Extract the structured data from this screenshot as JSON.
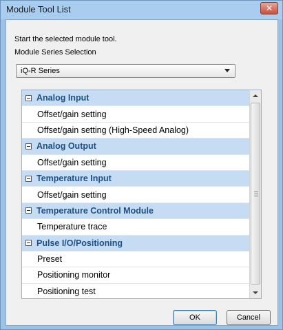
{
  "window": {
    "title": "Module Tool List",
    "close_glyph": "✕"
  },
  "dialog": {
    "instruction": "Start the selected module tool.",
    "series_label": "Module Series Selection",
    "series_value": "iQ-R Series"
  },
  "tree": {
    "groups": [
      {
        "label": "Analog Input",
        "items": [
          "Offset/gain setting",
          "Offset/gain setting (High-Speed Analog)"
        ]
      },
      {
        "label": "Analog Output",
        "items": [
          "Offset/gain setting"
        ]
      },
      {
        "label": "Temperature Input",
        "items": [
          "Offset/gain setting"
        ]
      },
      {
        "label": "Temperature Control Module",
        "items": [
          "Temperature trace"
        ]
      },
      {
        "label": "Pulse I/O/Positioning",
        "items": [
          "Preset",
          "Positioning monitor",
          "Positioning test"
        ]
      }
    ]
  },
  "buttons": {
    "ok": "OK",
    "cancel": "Cancel"
  },
  "colors": {
    "group_bg": "#c6dcf2",
    "group_text": "#1d4f86",
    "close_button": "#c7503d"
  }
}
